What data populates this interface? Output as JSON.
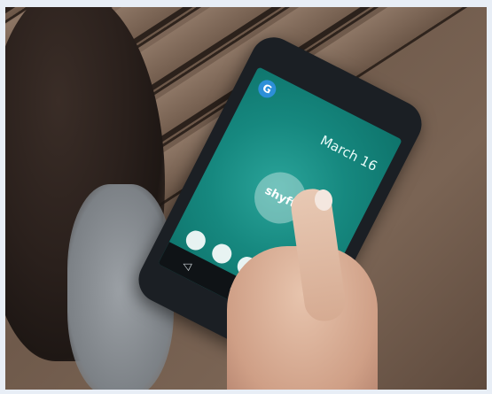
{
  "photo": {
    "subject": "Hand holding an Android smartphone over a wooden table",
    "screen": {
      "status_bar": "",
      "google_badge": "G",
      "date": "March 16",
      "logo_text": "shyft",
      "dock_icons": [
        "phone-icon",
        "email-icon",
        "chrome-icon",
        "settings-icon",
        "camera-icon"
      ],
      "nav_buttons": [
        "back-icon",
        "home-icon",
        "recents-icon"
      ]
    },
    "colors": {
      "screen_teal": "#16887f",
      "phone_body": "#1b1f24",
      "wood": "#7a6454",
      "background_frame": "#e8eef6"
    }
  }
}
